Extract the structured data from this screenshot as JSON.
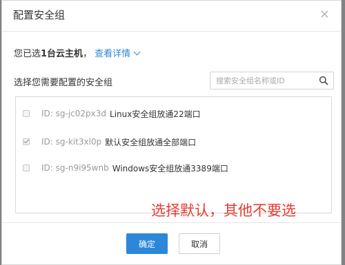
{
  "dialog": {
    "title": "配置安全组",
    "close_glyph": "×",
    "selected_prefix": "您已选",
    "selected_count": "1台云主机",
    "selected_sep": "，",
    "detail_link": "查看详情",
    "choose_label": "选择您需要配置的安全组",
    "search_placeholder": "搜索安全组名称或ID",
    "items": [
      {
        "id_label": "ID: sg-jc02px3d",
        "name": "Linux安全组放通22端口",
        "checked": false
      },
      {
        "id_label": "ID: sg-kit3xl0p",
        "name": "默认安全组放通全部端口",
        "checked": true
      },
      {
        "id_label": "ID: sg-n9i95wnb",
        "name": "Windows安全组放通3389端口",
        "checked": false
      }
    ],
    "annotation": "选择默认，其他不要选",
    "ok_label": "确定",
    "cancel_label": "取消"
  },
  "colors": {
    "accent": "#2c86d9",
    "annotation": "#e63a32",
    "backdrop": "#7f8387"
  },
  "icons": {
    "search": "search-icon",
    "close": "close-icon",
    "detail_expand": "chevron-down-icon",
    "check": "checkmark-icon"
  }
}
